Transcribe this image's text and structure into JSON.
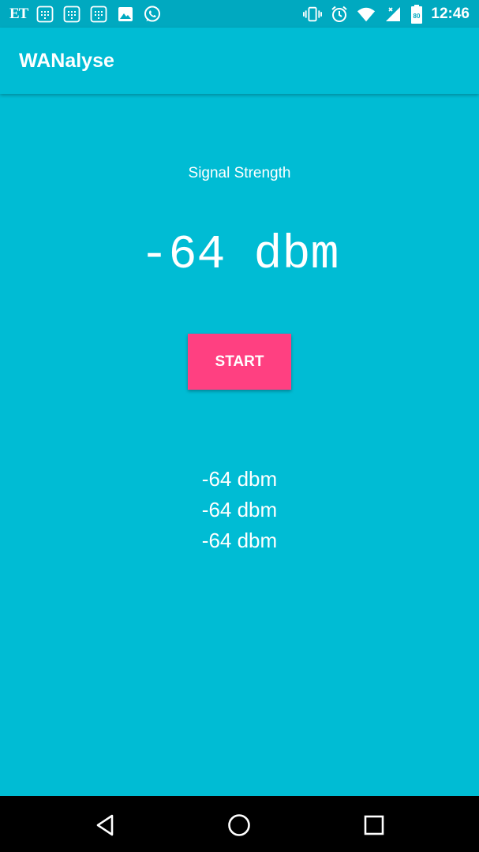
{
  "status_bar": {
    "left_logo": "ET",
    "time": "12:46",
    "battery_level": "80",
    "icons_left": [
      "et-logo",
      "calendar-icon",
      "calendar-icon",
      "calendar-icon",
      "image-icon",
      "whatsapp-icon"
    ],
    "icons_right": [
      "vibrate-icon",
      "alarm-icon",
      "wifi-icon",
      "signal-icon",
      "battery-icon"
    ]
  },
  "app_bar": {
    "title": "WANalyse"
  },
  "main": {
    "signal_label": "Signal Strength",
    "signal_value": "-64 dbm",
    "start_label": "START",
    "readings": [
      "-64 dbm",
      "-64 dbm",
      "-64 dbm"
    ]
  },
  "nav_bar": {
    "buttons": [
      "back-icon",
      "home-icon",
      "recents-icon"
    ]
  },
  "colors": {
    "background": "#00BCD4",
    "status_bar": "#00A9C0",
    "accent": "#FF4081",
    "nav_bar": "#000000",
    "text": "#FFFFFF"
  }
}
